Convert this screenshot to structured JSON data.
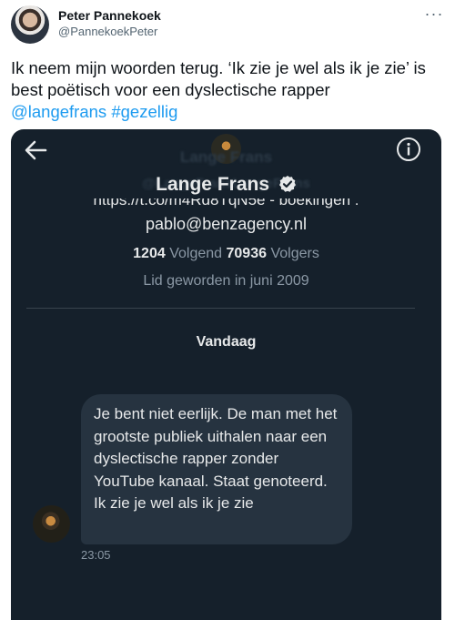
{
  "tweet": {
    "author_name": "Peter Pannekoek",
    "author_handle": "@PannekoekPeter",
    "text_plain": "Ik neem mijn woorden terug. ‘Ik zie je wel als ik je zie’ is best poëtisch voor een dyslectische rapper",
    "mention": "@langefrans",
    "hashtag": "#gezellig",
    "more_icon": "more-horizontal-icon"
  },
  "screenshot": {
    "ghost_title": "Lange Frans",
    "ghost_bio": "@LangeFransLangeFrans",
    "profile_name": "Lange Frans",
    "bio_link_line": "https://t.co/m4Rd8TqN5e - boekingen :",
    "bio_email": "pablo@benzagency.nl",
    "following_count": "1204",
    "following_label": "Volgend",
    "followers_count": "70936",
    "followers_label": "Volgers",
    "joined": "Lid geworden in juni 2009",
    "day_label": "Vandaag",
    "message": "Je bent niet eerlijk. De man met het grootste publiek uithalen naar een dyslectische rapper zonder YouTube kanaal. Staat genoteerd. Ik zie je wel als ik je zie",
    "message_time": "23:05",
    "icons": [
      "back-arrow-icon",
      "info-icon",
      "verified-badge-icon"
    ],
    "colors": {
      "background": "#15202b",
      "bubble": "#263340",
      "link": "#1d9bf0"
    }
  }
}
